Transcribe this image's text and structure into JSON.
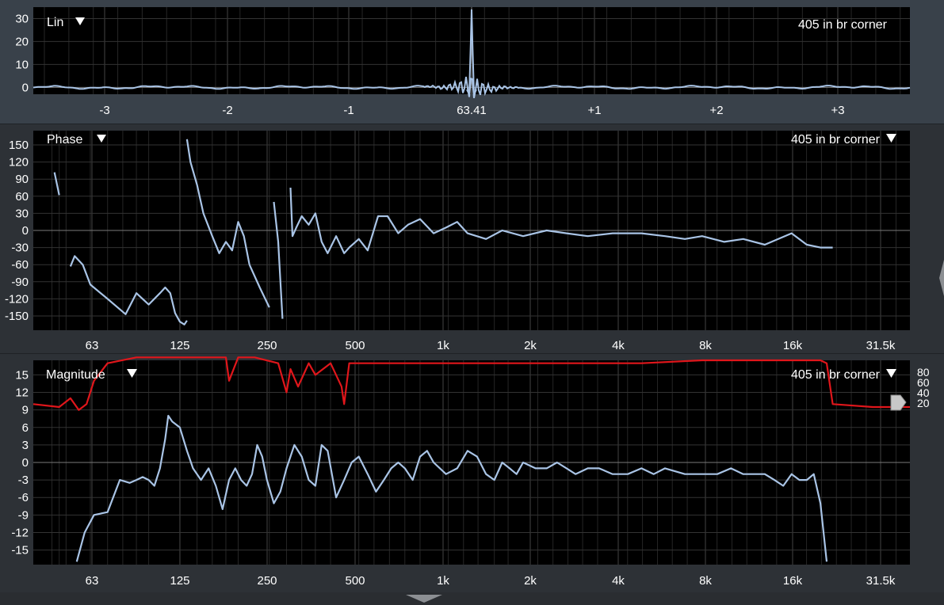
{
  "lin": {
    "label": "Lin",
    "selector": "405 in br corner",
    "y_ticks": [
      "30",
      "20",
      "10",
      "0"
    ],
    "x_ticks": [
      "-3",
      "-2",
      "-1",
      "63.41",
      "+1",
      "+2",
      "+3"
    ]
  },
  "phase": {
    "label": "Phase",
    "selector": "405 in br corner",
    "y_ticks": [
      "150",
      "120",
      "90",
      "60",
      "30",
      "0",
      "-30",
      "-60",
      "-90",
      "-120",
      "-150"
    ],
    "freq_ticks": [
      "63",
      "125",
      "250",
      "500",
      "1k",
      "2k",
      "4k",
      "8k",
      "16k",
      "31.5k"
    ]
  },
  "magnitude": {
    "label": "Magnitude",
    "selector": "405 in br corner",
    "y_ticks": [
      "15",
      "12",
      "9",
      "6",
      "3",
      "0",
      "-3",
      "-6",
      "-9",
      "-12",
      "-15"
    ],
    "coherence_ticks": [
      "80",
      "60",
      "40",
      "20"
    ],
    "freq_ticks": [
      "63",
      "125",
      "250",
      "500",
      "1k",
      "2k",
      "4k",
      "8k",
      "16k",
      "31.5k"
    ]
  },
  "colors": {
    "trace": "#a9c4e6",
    "coherence": "#e0161b",
    "plot_bg": "#000000",
    "grid": "#3b3b3b",
    "zero_line": "#7a7a7a",
    "label_text": "#ffffff"
  },
  "chart_data": [
    {
      "type": "line",
      "title": "Lin",
      "x_unit_ticks": [
        "-3",
        "-2",
        "-1",
        "63.41",
        "+1",
        "+2",
        "+3"
      ],
      "ylim": [
        -3,
        35
      ],
      "series": [
        {
          "name": "405 in br corner",
          "peak_x": 0,
          "peak_y": 34,
          "baseline_y": 0
        }
      ]
    },
    {
      "type": "line",
      "title": "Phase",
      "xscale": "log",
      "xlim": [
        45,
        40000
      ],
      "ylim": [
        -175,
        175
      ],
      "series": [
        {
          "name": "405 in br corner",
          "segments": [
            {
              "x": [
                53,
                55
              ],
              "y": [
                102,
                62
              ]
            },
            {
              "x": [
                60,
                62,
                66,
                70,
                80,
                92,
                100,
                110,
                120,
                125,
                130,
                135,
                140,
                145,
                148
              ],
              "y": [
                -63,
                -45,
                -60,
                -95,
                -120,
                -147,
                -110,
                -130,
                -110,
                -100,
                -110,
                -145,
                -160,
                -165,
                -158
              ]
            },
            {
              "x": [
                148,
                152,
                160,
                168,
                180,
                190,
                200,
                210,
                220,
                230,
                240
              ],
              "y": [
                160,
                120,
                80,
                30,
                -10,
                -40,
                -20,
                -35,
                15,
                -10,
                -60
              ]
            },
            {
              "x": [
                240,
                260,
                280
              ],
              "y": [
                -60,
                -100,
                -135
              ]
            },
            {
              "x": [
                290,
                300,
                310
              ],
              "y": [
                50,
                -20,
                -155
              ]
            },
            {
              "x": [
                330,
                335,
                345,
                360,
                380,
                400,
                420,
                440,
                470,
                500,
                520,
                560,
                600,
                650,
                700,
                760,
                820,
                900,
                1000,
                1100,
                1200,
                1300,
                1500,
                1700,
                2000,
                2400,
                2800,
                3300,
                4000,
                5000,
                6000,
                7000,
                8000,
                9500,
                11000,
                13000,
                16000,
                18000,
                20000,
                22000
              ],
              "y": [
                75,
                -10,
                5,
                25,
                10,
                30,
                -20,
                -40,
                -10,
                -40,
                -30,
                -15,
                -35,
                25,
                25,
                -5,
                10,
                20,
                -5,
                5,
                15,
                -5,
                -15,
                0,
                -10,
                0,
                -5,
                -10,
                -5,
                -5,
                -10,
                -15,
                -10,
                -20,
                -15,
                -25,
                -5,
                -25,
                -30,
                -30
              ]
            }
          ]
        }
      ]
    },
    {
      "type": "line",
      "title": "Magnitude",
      "xscale": "log",
      "xlim": [
        45,
        40000
      ],
      "ylim": [
        -17.5,
        17.5
      ],
      "series": [
        {
          "name": "405 in br corner",
          "x": [
            63,
            67,
            72,
            80,
            88,
            95,
            100,
            105,
            110,
            115,
            120,
            125,
            128,
            132,
            140,
            148,
            155,
            165,
            175,
            185,
            195,
            205,
            215,
            225,
            235,
            245,
            255,
            265,
            275,
            290,
            305,
            320,
            340,
            360,
            380,
            400,
            420,
            440,
            470,
            500,
            530,
            560,
            600,
            640,
            680,
            720,
            760,
            800,
            850,
            900,
            950,
            1000,
            1100,
            1200,
            1300,
            1400,
            1500,
            1600,
            1700,
            1800,
            1900,
            2000,
            2200,
            2400,
            2600,
            2800,
            3000,
            3300,
            3600,
            4000,
            4500,
            5000,
            5500,
            6000,
            7000,
            8000,
            9000,
            10000,
            11000,
            12000,
            13000,
            14000,
            15000,
            16000,
            17000,
            18000,
            19000,
            20000,
            21000
          ],
          "y": [
            -17,
            -12,
            -9,
            -8.5,
            -3,
            -3.5,
            -3,
            -2.5,
            -3,
            -4,
            -1,
            4,
            8,
            7,
            6,
            2,
            -1,
            -3,
            -1,
            -4,
            -8,
            -3,
            -1,
            -3,
            -4,
            -2,
            3,
            1,
            -3,
            -7,
            -5,
            -1,
            3,
            1,
            -3,
            -4,
            3,
            2,
            -6,
            -3,
            0,
            1,
            -2,
            -5,
            -3,
            -1,
            0,
            -1,
            -3,
            1,
            2,
            0,
            -2,
            -1,
            2,
            1,
            -2,
            -3,
            0,
            -1,
            -2,
            0,
            -1,
            -1,
            0,
            -1,
            -2,
            -1,
            -1,
            -2,
            -2,
            -1,
            -2,
            -1,
            -2,
            -2,
            -2,
            -1,
            -2,
            -2,
            -2,
            -3,
            -4,
            -2,
            -3,
            -3,
            -2,
            -7,
            -17
          ]
        },
        {
          "name": "coherence",
          "x": [
            45,
            55,
            60,
            64,
            68,
            72,
            80,
            100,
            150,
            200,
            205,
            220,
            250,
            300,
            320,
            330,
            350,
            380,
            400,
            450,
            490,
            500,
            520,
            600,
            700,
            800,
            1000,
            1500,
            2000,
            3000,
            5000,
            8000,
            12000,
            16000,
            20000,
            21000,
            22000,
            25000,
            30000,
            40000
          ],
          "y": [
            10,
            9.5,
            11,
            9,
            10,
            14,
            17,
            18,
            18,
            18,
            14,
            18,
            18,
            17,
            12,
            16,
            13,
            17,
            15,
            17,
            13,
            10,
            17,
            17,
            17,
            17,
            17,
            17,
            17,
            17,
            17,
            17.5,
            17.5,
            17.5,
            17.5,
            17,
            10,
            9.8,
            9.5,
            9.5
          ]
        }
      ]
    }
  ]
}
